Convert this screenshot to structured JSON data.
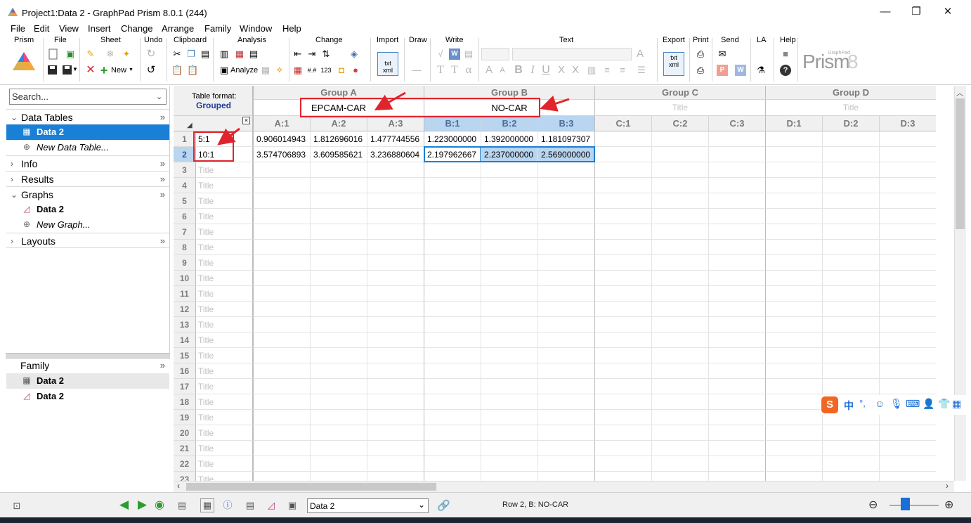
{
  "window": {
    "title": "Project1:Data 2 - GraphPad Prism 8.0.1 (244)",
    "minimize": "—",
    "restore": "❐",
    "close": "✕"
  },
  "menu": [
    "File",
    "Edit",
    "View",
    "Insert",
    "Change",
    "Arrange",
    "Family",
    "Window",
    "Help"
  ],
  "ribbon": {
    "groups": [
      "Prism",
      "File",
      "Sheet",
      "Undo",
      "Clipboard",
      "Analysis",
      "Change",
      "Import",
      "Draw",
      "Write",
      "Text",
      "Export",
      "Print",
      "Send",
      "LA",
      "Help"
    ],
    "new_label": "New",
    "analyze_label": "Analyze",
    "logo_text": "Prism",
    "logo_version": "8",
    "logo_brand": "GraphPad"
  },
  "navigator": {
    "search_placeholder": "Search...",
    "sections": [
      {
        "label": "Data Tables",
        "expanded": true,
        "items": [
          {
            "label": "Data 2",
            "selected": true,
            "icon": "table-icon"
          },
          {
            "label": "New Data Table...",
            "italic": true,
            "icon": "add-icon"
          }
        ]
      },
      {
        "label": "Info",
        "expanded": false,
        "items": []
      },
      {
        "label": "Results",
        "expanded": false,
        "items": []
      },
      {
        "label": "Graphs",
        "expanded": true,
        "items": [
          {
            "label": "Data 2",
            "icon": "graph-icon"
          },
          {
            "label": "New Graph...",
            "italic": true,
            "icon": "add-icon"
          }
        ]
      },
      {
        "label": "Layouts",
        "expanded": false,
        "items": []
      }
    ],
    "expand_glyph": "»"
  },
  "family": {
    "label": "Family",
    "items": [
      {
        "label": "Data 2",
        "icon": "table-icon"
      },
      {
        "label": "Data 2",
        "icon": "graph-icon"
      }
    ]
  },
  "sheet": {
    "table_format_label": "Table format:",
    "table_format_value": "Grouped",
    "groups": [
      {
        "name": "Group A",
        "title": "EPCAM-CAR",
        "cols": [
          "A:1",
          "A:2",
          "A:3"
        ]
      },
      {
        "name": "Group B",
        "title": "NO-CAR",
        "cols": [
          "B:1",
          "B:2",
          "B:3"
        ]
      },
      {
        "name": "Group C",
        "title": "Title",
        "cols": [
          "C:1",
          "C:2",
          "C:3"
        ]
      },
      {
        "name": "Group D",
        "title": "Title",
        "cols": [
          "D:1",
          "D:2",
          "D:3"
        ]
      }
    ],
    "row_title_placeholder": "Title",
    "rows": [
      {
        "n": "1",
        "title": "5:1",
        "values": [
          "0.906014943",
          "1.812696016",
          "1.477744556",
          "1.223000000",
          "1.392000000",
          "1.181097307"
        ]
      },
      {
        "n": "2",
        "title": "10:1",
        "values": [
          "3.574706893",
          "3.609585621",
          "3.236880604",
          "2.197962667",
          "2.237000000",
          "2.569000000"
        ]
      },
      {
        "n": "3"
      },
      {
        "n": "4"
      },
      {
        "n": "5"
      },
      {
        "n": "6"
      },
      {
        "n": "7"
      },
      {
        "n": "8"
      },
      {
        "n": "9"
      },
      {
        "n": "10"
      },
      {
        "n": "11"
      },
      {
        "n": "12"
      },
      {
        "n": "13"
      },
      {
        "n": "14"
      },
      {
        "n": "15"
      },
      {
        "n": "16"
      },
      {
        "n": "17"
      },
      {
        "n": "18"
      },
      {
        "n": "19"
      },
      {
        "n": "20"
      },
      {
        "n": "21"
      },
      {
        "n": "22"
      },
      {
        "n": "23"
      }
    ]
  },
  "status": {
    "sheet_select": "Data 2",
    "position_text": "Row 2, B: NO-CAR"
  },
  "ime": {
    "cn": "中"
  },
  "colors": {
    "selection": "#1a7fd6",
    "accent_red": "#e0242c",
    "header_blue": "#b9d5f0"
  }
}
